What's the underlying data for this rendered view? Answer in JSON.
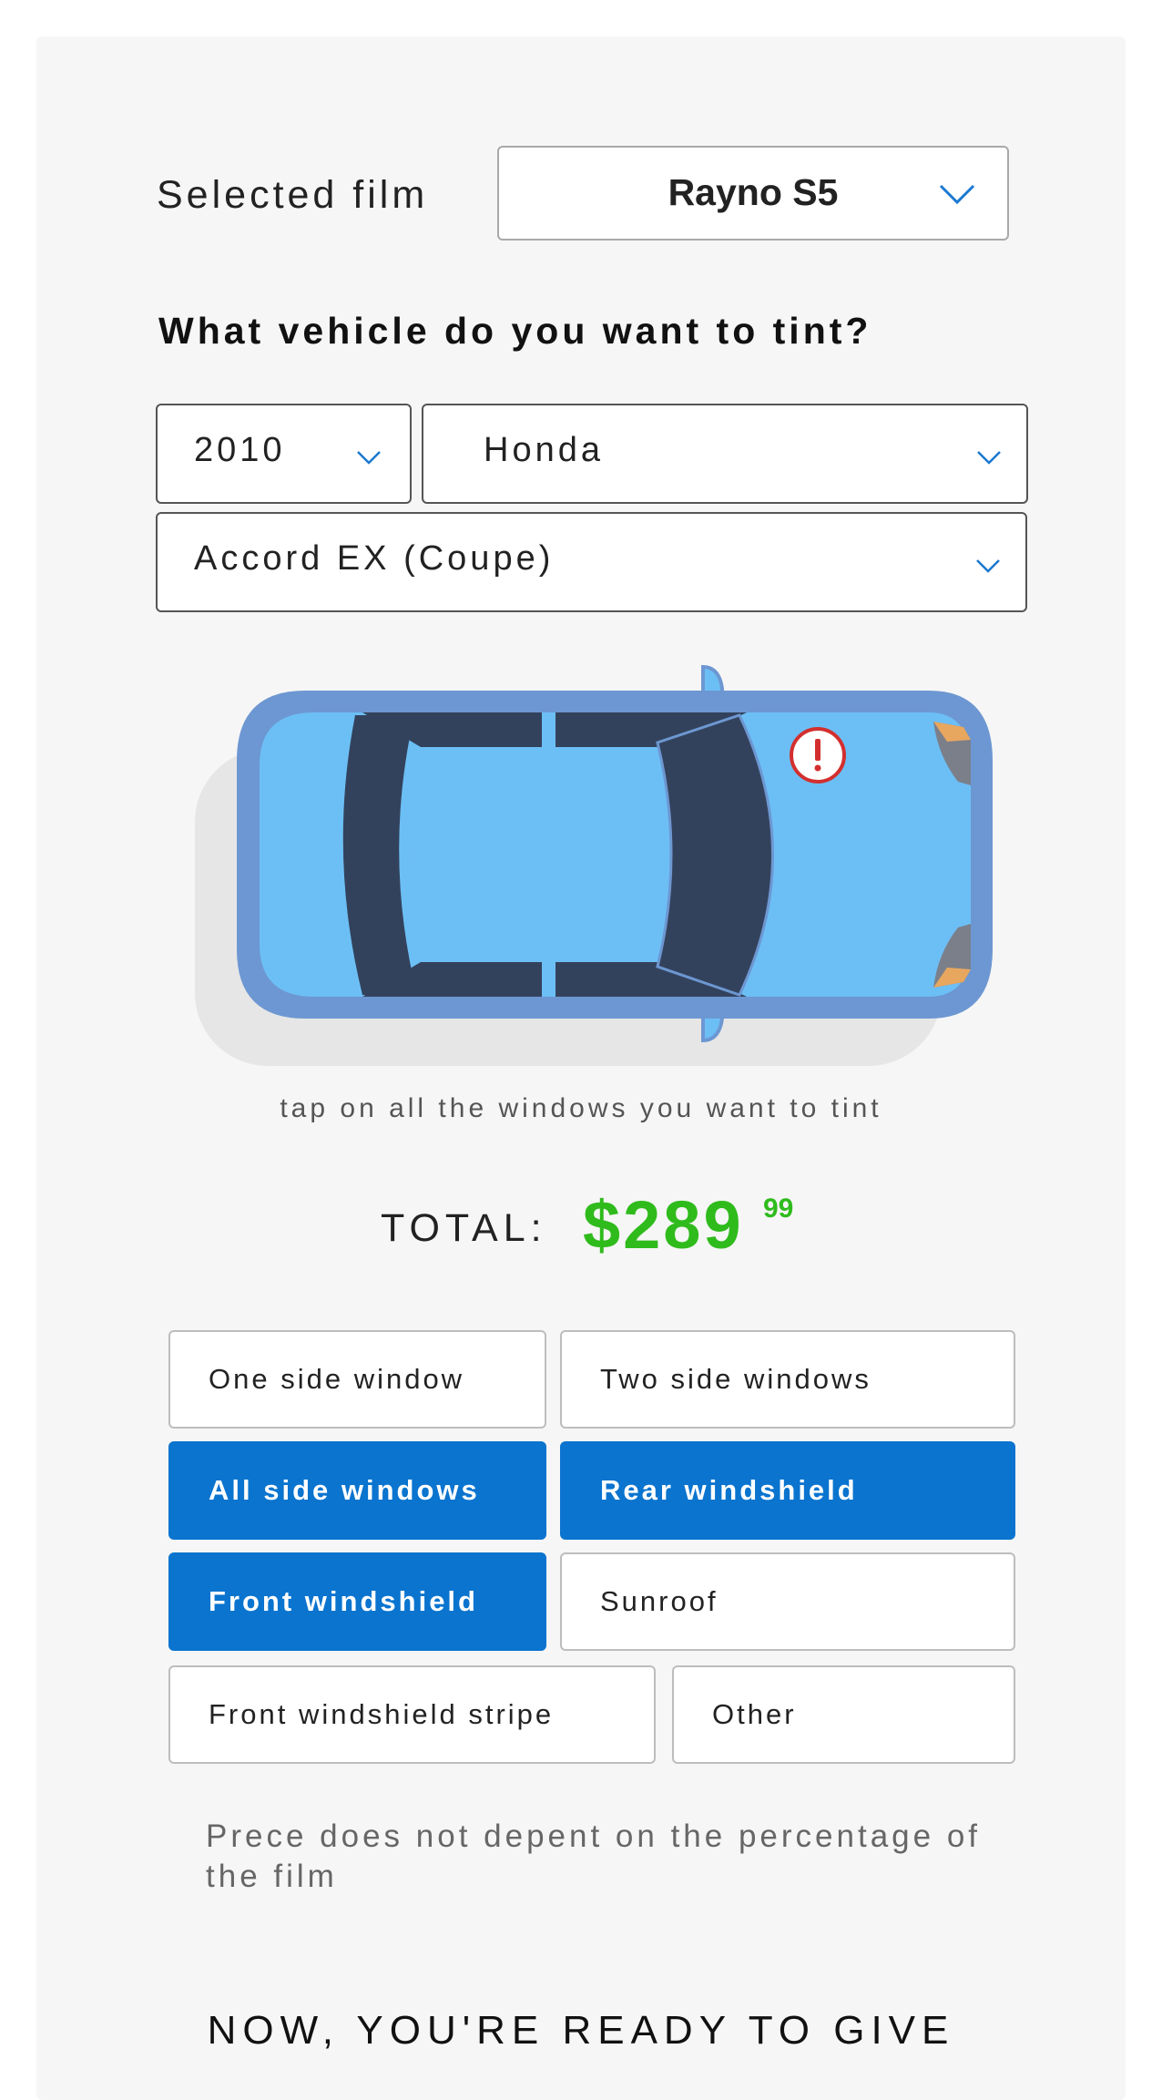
{
  "film": {
    "label": "Selected film",
    "selected": "Rayno S5"
  },
  "vehicle": {
    "question": "What vehicle do you want to tint?",
    "year": "2010",
    "make": "Honda",
    "model": "Accord EX (Coupe)"
  },
  "car": {
    "hint": "tap on all the windows you want to tint",
    "warning_icon": "exclamation-circle-icon"
  },
  "total": {
    "label": "TOTAL:",
    "price": "$289",
    "cents": "99"
  },
  "options": [
    {
      "label": "One side window",
      "selected": false
    },
    {
      "label": "Two side windows",
      "selected": false
    },
    {
      "label": "All side windows",
      "selected": true
    },
    {
      "label": "Rear windshield",
      "selected": true
    },
    {
      "label": "Front windshield",
      "selected": true
    },
    {
      "label": "Sunroof",
      "selected": false
    },
    {
      "label": "Front windshield stripe",
      "selected": false
    },
    {
      "label": "Other",
      "selected": false
    }
  ],
  "note": "Prece does not depent on the percentage of the film",
  "footer": "NOW, YOU'RE READY TO GIVE",
  "colors": {
    "accent": "#0a74cf",
    "price": "#2fbb1c",
    "car_body": "#6cbff5",
    "car_outline": "#6d97d2",
    "car_glass": "#33425c",
    "warning": "#d32f2f"
  }
}
